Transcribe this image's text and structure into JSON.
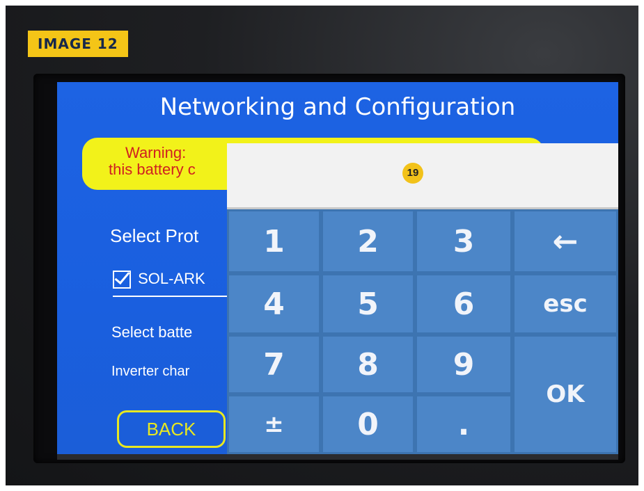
{
  "tag": "IMAGE 12",
  "screen": {
    "title": "Networking and Configuration",
    "warning_line1": "Warning:",
    "warning_line2": "this battery c",
    "select_protocol": "Select Prot",
    "protocol_option": "SOL-ARK",
    "select_battery": "Select batte",
    "inverter_charge": "Inverter char",
    "back_label": "BACK"
  },
  "keypad": {
    "display_value": "19",
    "keys": [
      "1",
      "2",
      "3",
      "←",
      "4",
      "5",
      "6",
      "esc",
      "7",
      "8",
      "9",
      "OK",
      "±",
      "0",
      "."
    ]
  }
}
